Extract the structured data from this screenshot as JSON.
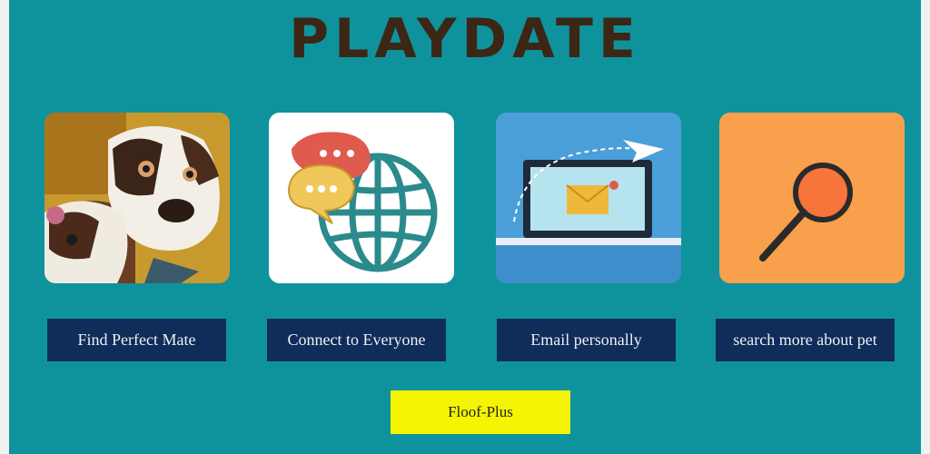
{
  "app": {
    "title": "PLAYDATE"
  },
  "features": [
    {
      "label": "Find Perfect Mate",
      "image": "dogs-photo"
    },
    {
      "label": "Connect to Everyone",
      "image": "globe-chat-icon"
    },
    {
      "label": "Email personally",
      "image": "laptop-email-icon"
    },
    {
      "label": "search more about pet",
      "image": "magnifier-icon"
    }
  ],
  "cta": {
    "label": "Floof-Plus"
  },
  "colors": {
    "background": "#0e939d",
    "title": "#3c2615",
    "button": "#0f2c5a",
    "cta": "#f4f403"
  }
}
